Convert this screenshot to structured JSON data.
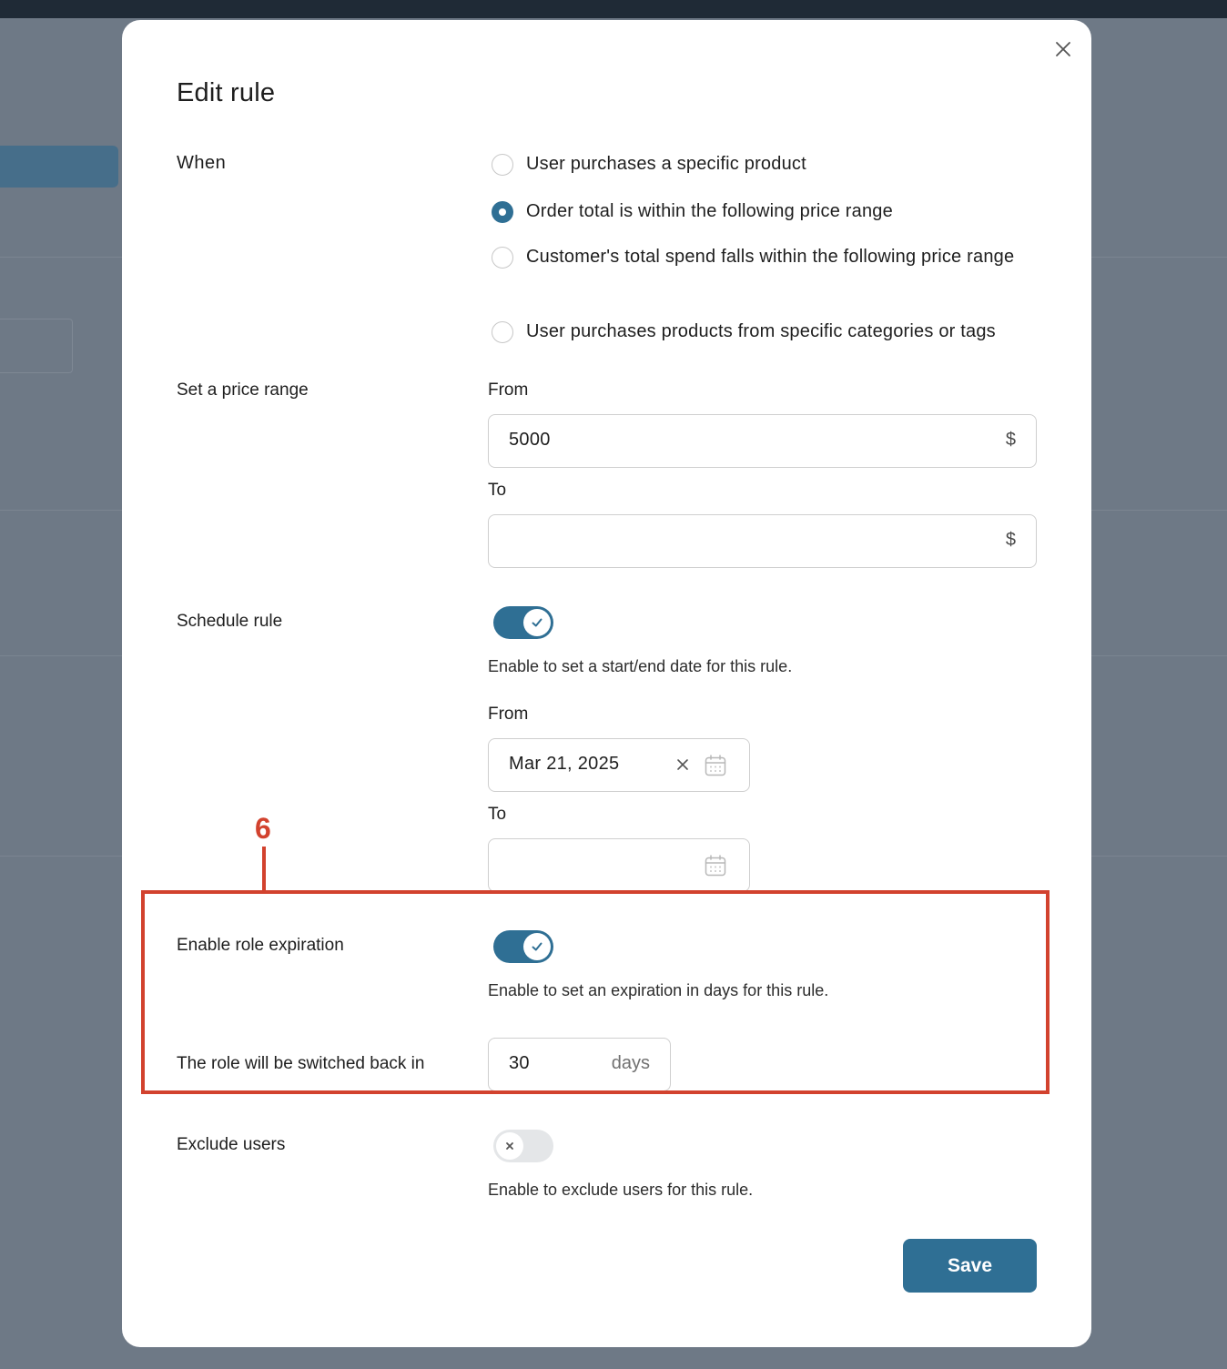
{
  "modal": {
    "title": "Edit rule",
    "close_icon": "close-icon"
  },
  "when": {
    "label": "When",
    "options": [
      "User purchases a specific product",
      "Order total is within the following price range",
      "Customer's total spend falls within the following price range",
      "User purchases products from specific categories or tags"
    ],
    "selected_index": 1
  },
  "price_range": {
    "label": "Set a price range",
    "from_label": "From",
    "from_value": "5000",
    "from_suffix": "$",
    "to_label": "To",
    "to_value": "",
    "to_suffix": "$"
  },
  "schedule": {
    "label": "Schedule rule",
    "enabled": true,
    "help": "Enable to set a start/end date for this rule.",
    "from_label": "From",
    "from_value": "Mar 21, 2025",
    "to_label": "To",
    "to_value": ""
  },
  "role_expiration": {
    "label": "Enable role expiration",
    "enabled": true,
    "help": "Enable to set an expiration in days for this rule.",
    "switch_back_label": "The role will be switched back in",
    "days_value": "30",
    "days_suffix": "days"
  },
  "exclude_users": {
    "label": "Exclude users",
    "enabled": false,
    "help": "Enable to exclude users for this rule."
  },
  "annotation": {
    "number": "6",
    "color": "#d2422e"
  },
  "actions": {
    "save_label": "Save"
  },
  "colors": {
    "accent": "#2f6f94"
  }
}
